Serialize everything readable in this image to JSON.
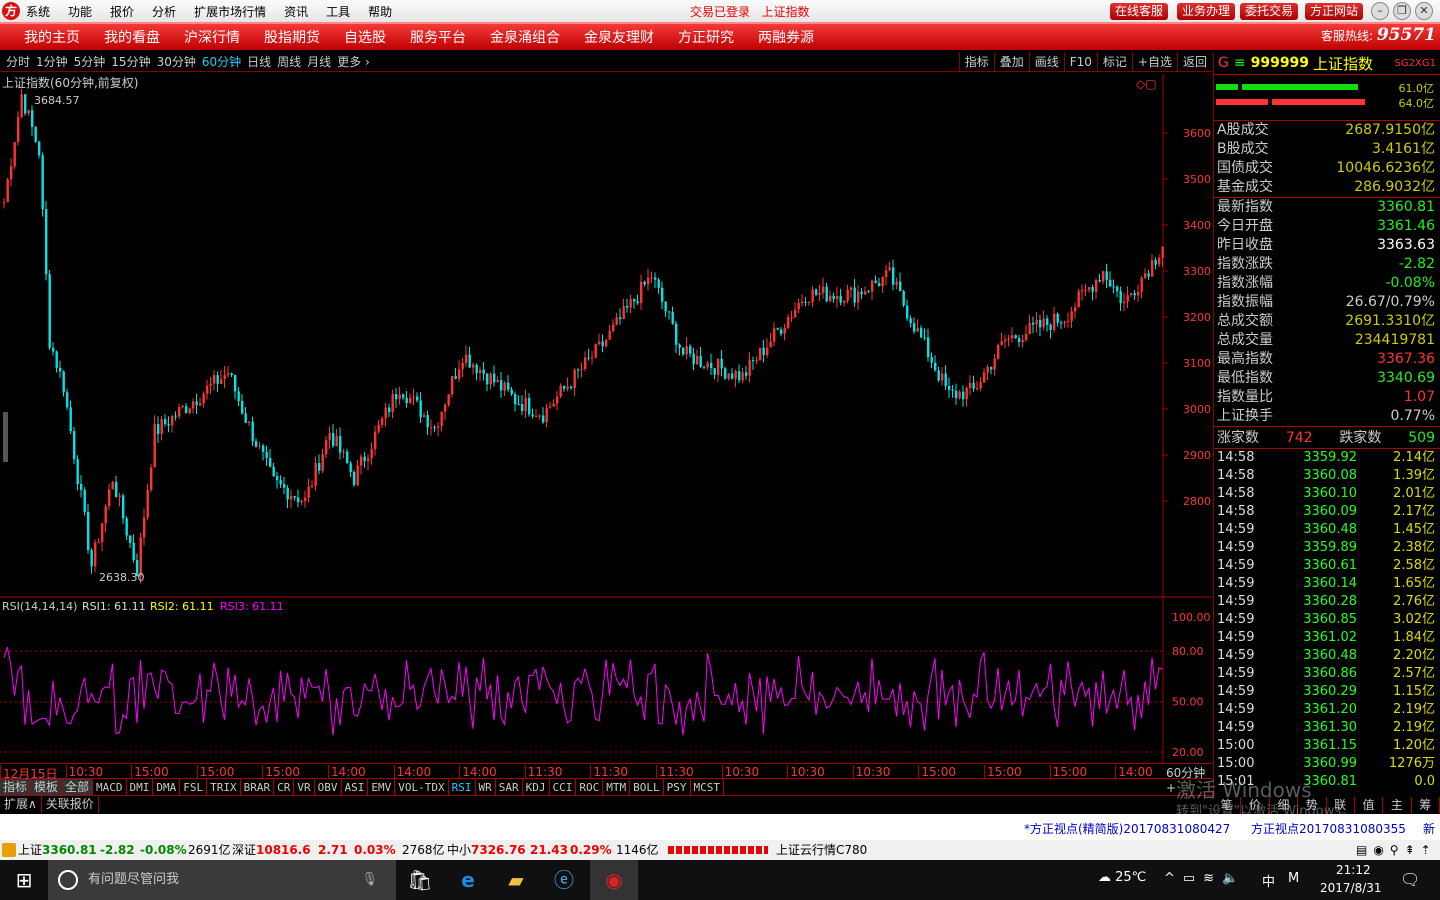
{
  "titlebar": {
    "menu": [
      "系统",
      "功能",
      "报价",
      "分析",
      "扩展市场行情",
      "资讯",
      "工具",
      "帮助"
    ],
    "status": "交易已登录",
    "title": "上证指数",
    "buttons": [
      "在线客服",
      "业务办理",
      "委托交易",
      "方正网站"
    ],
    "logo": "方"
  },
  "nav": {
    "items": [
      "我的主页",
      "我的看盘",
      "沪深行情",
      "股指期货",
      "自选股",
      "服务平台",
      "金泉涌组合",
      "金泉友理财",
      "方正研究",
      "两融券源"
    ],
    "hotline_label": "客服热线:",
    "hotline": "95571"
  },
  "periods": {
    "items": [
      "分时",
      "1分钟",
      "5分钟",
      "15分钟",
      "30分钟",
      "60分钟",
      "日线",
      "周线",
      "月线",
      "更多 ›"
    ],
    "active": "60分钟"
  },
  "tools": [
    "指标",
    "叠加",
    "画线",
    "F10",
    "标记",
    "+自选",
    "返回"
  ],
  "chart": {
    "title": "上证指数(60分钟,前复权)",
    "high_label": "3684.57",
    "low_label": "2638.30",
    "price_ticks": [
      "3600",
      "3500",
      "3400",
      "3300",
      "3200",
      "3100",
      "3000",
      "2900",
      "2800"
    ],
    "rsi_title": "RSI(14,14,14)",
    "rsi1": "RSI1: 61.11",
    "rsi2": "RSI2: 61.11",
    "rsi3": "RSI3: 61.11",
    "rsi_ticks": [
      "100.00",
      "80.00",
      "50.00",
      "20.00"
    ],
    "time_labels": [
      "12月15日",
      "10:30",
      "15:00",
      "15:00",
      "15:00",
      "14:00",
      "14:00",
      "14:00",
      "11:30",
      "11:30",
      "11:30",
      "10:30",
      "10:30",
      "10:30",
      "15:00",
      "15:00",
      "15:00",
      "14:00"
    ],
    "period_label": "60分钟",
    "colors": {
      "up": "#ff3232",
      "down": "#00e4e4",
      "rsi": "#ff00ff"
    }
  },
  "chart_data": {
    "type": "candlestick",
    "ylim": [
      2600,
      3720
    ],
    "keypoints_bar_close": [
      [
        0,
        3450
      ],
      [
        5,
        3684
      ],
      [
        10,
        3560
      ],
      [
        13,
        3150
      ],
      [
        17,
        3050
      ],
      [
        25,
        2660
      ],
      [
        31,
        2850
      ],
      [
        38,
        2650
      ],
      [
        43,
        2950
      ],
      [
        51,
        3000
      ],
      [
        64,
        3080
      ],
      [
        69,
        2980
      ],
      [
        77,
        2840
      ],
      [
        86,
        2800
      ],
      [
        93,
        2950
      ],
      [
        100,
        2850
      ],
      [
        113,
        3050
      ],
      [
        123,
        2960
      ],
      [
        131,
        3120
      ],
      [
        146,
        3020
      ],
      [
        154,
        2990
      ],
      [
        171,
        3140
      ],
      [
        185,
        3290
      ],
      [
        194,
        3120
      ],
      [
        211,
        3070
      ],
      [
        229,
        3250
      ],
      [
        243,
        3250
      ],
      [
        253,
        3290
      ],
      [
        270,
        3030
      ],
      [
        277,
        3040
      ],
      [
        286,
        3150
      ],
      [
        303,
        3200
      ],
      [
        314,
        3300
      ],
      [
        320,
        3230
      ],
      [
        329,
        3330
      ],
      [
        331,
        3360
      ]
    ],
    "rsi_range": [
      20,
      100
    ]
  },
  "panel": {
    "code": "999999",
    "name": "上证指数",
    "g": "G",
    "sg": "SG2XG1",
    "bar1": "61.0亿",
    "bar2": "64.0亿",
    "turnover": [
      [
        "A股成交",
        "2687.9150亿"
      ],
      [
        "B股成交",
        "3.4161亿"
      ],
      [
        "国债成交",
        "10046.6236亿"
      ],
      [
        "基金成交",
        "286.9032亿"
      ]
    ],
    "stats": [
      [
        "最新指数",
        "3360.81",
        "g"
      ],
      [
        "今日开盘",
        "3361.46",
        "g"
      ],
      [
        "昨日收盘",
        "3363.63",
        "w"
      ],
      [
        "指数涨跌",
        "-2.82",
        "g"
      ],
      [
        "指数涨幅",
        "-0.08%",
        "g"
      ],
      [
        "指数振幅",
        "26.67/0.79%",
        "gr"
      ],
      [
        "总成交额",
        "2691.3310亿",
        "y"
      ],
      [
        "总成交量",
        "234419781",
        "y"
      ],
      [
        "最高指数",
        "3367.36",
        "r"
      ],
      [
        "最低指数",
        "3340.69",
        "g"
      ],
      [
        "指数量比",
        "1.07",
        "r"
      ],
      [
        "上证换手",
        "0.77%",
        "gr"
      ]
    ],
    "up_label": "涨家数",
    "up": "742",
    "down_label": "跌家数",
    "down": "509",
    "ticks": [
      [
        "14:58",
        "3359.92",
        "2.14亿"
      ],
      [
        "14:58",
        "3360.08",
        "1.39亿"
      ],
      [
        "14:58",
        "3360.10",
        "2.01亿"
      ],
      [
        "14:58",
        "3360.09",
        "2.17亿"
      ],
      [
        "14:59",
        "3360.48",
        "1.45亿"
      ],
      [
        "14:59",
        "3359.89",
        "2.38亿"
      ],
      [
        "14:59",
        "3360.61",
        "2.58亿"
      ],
      [
        "14:59",
        "3360.14",
        "1.65亿"
      ],
      [
        "14:59",
        "3360.28",
        "2.76亿"
      ],
      [
        "14:59",
        "3360.85",
        "3.02亿"
      ],
      [
        "14:59",
        "3361.02",
        "1.84亿"
      ],
      [
        "14:59",
        "3360.48",
        "2.20亿"
      ],
      [
        "14:59",
        "3360.86",
        "2.57亿"
      ],
      [
        "14:59",
        "3360.29",
        "1.15亿"
      ],
      [
        "14:59",
        "3361.20",
        "2.19亿"
      ],
      [
        "14:59",
        "3361.30",
        "2.19亿"
      ],
      [
        "15:00",
        "3361.15",
        "1.20亿"
      ],
      [
        "15:00",
        "3360.99",
        "1276万"
      ],
      [
        "15:01",
        "3360.81",
        "0.0"
      ]
    ],
    "tabs": [
      "笔",
      "价",
      "细",
      "势",
      "联",
      "值",
      "主",
      "筹"
    ]
  },
  "indicators": {
    "cn": [
      "指标",
      "模板",
      "全部"
    ],
    "items": [
      "MACD",
      "DMI",
      "DMA",
      "FSL",
      "TRIX",
      "BRAR",
      "CR",
      "VR",
      "OBV",
      "ASI",
      "EMV",
      "VOL-TDX",
      "RSI",
      "WR",
      "SAR",
      "KDJ",
      "CCI",
      "ROC",
      "MTM",
      "BOLL",
      "PSY",
      "MCST"
    ],
    "active": "RSI",
    "expand": [
      "扩展∧",
      "关联报价"
    ]
  },
  "news": [
    "*方正视点(精简版)20170831080427",
    "方正视点20170831080355",
    "新"
  ],
  "status": {
    "sh_label": "上证",
    "sh": "3360.81",
    "sh_chg": "-2.82",
    "sh_pct": "-0.08%",
    "sh_amt": "2691亿",
    "sz_label": "深证",
    "sz": "10816.6",
    "sz_chg": "2.71",
    "sz_pct": "0.03%",
    "sz_amt": "2768亿",
    "zx_label": "中小",
    "zx": "7326.76",
    "zx_chg": "21.43",
    "zx_pct": "0.29%",
    "zx_amt": "1146亿",
    "server": "上证云行情C780"
  },
  "watermark": {
    "line1": "激活 Windows",
    "line2": "转到\"设置\"以激活 Windows。"
  },
  "taskbar": {
    "search": "有问题尽管问我",
    "weather": "25℃",
    "ime": "中",
    "time": "21:12",
    "date": "2017/8/31",
    "notif": "1"
  }
}
